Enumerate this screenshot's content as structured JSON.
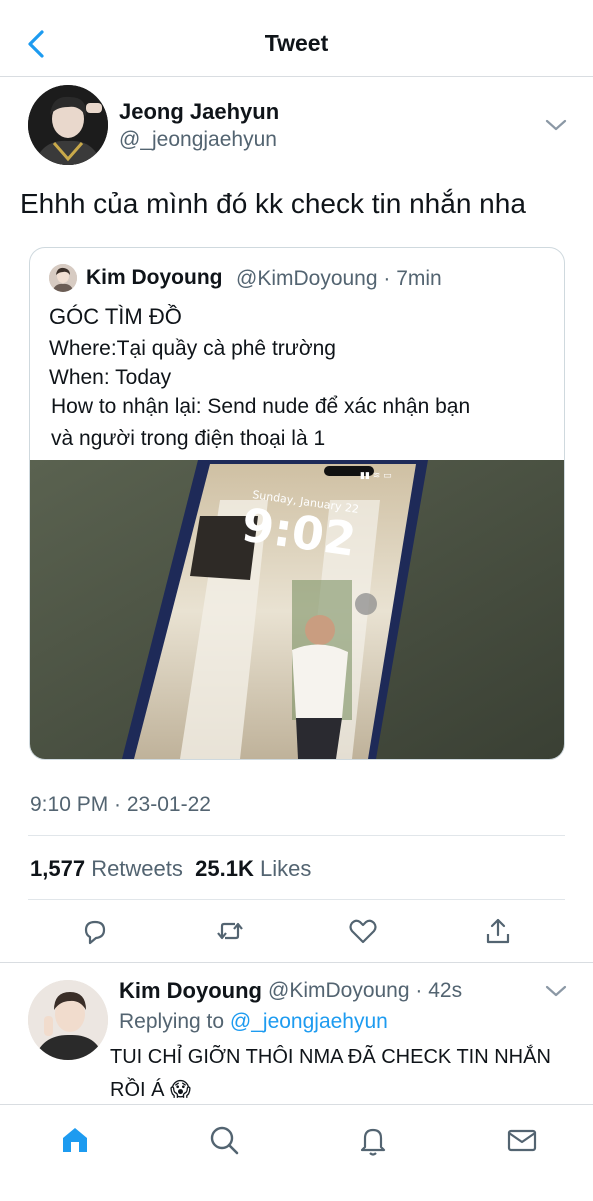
{
  "header": {
    "title": "Tweet",
    "back_icon": "chevron-left-icon"
  },
  "tweet": {
    "author_name": "Jeong Jaehyun",
    "author_handle": "@_jeongjaehyun",
    "text": "Ehhh của mình đó kk check tin nhắn nha",
    "quoted": {
      "author_name": "Kim Doyoung",
      "author_handle": "@KimDoyoung",
      "time": "· 7min",
      "lines": [
        "GÓC TÌM ĐỒ",
        "Where:Tại quầy cà phê trường",
        "When: Today",
        "How to nhận lại: Send nude để xác nhận bạn",
        "và người trong điện thoại là 1"
      ],
      "image": {
        "lock_date": "Sunday, January 22",
        "lock_time": "9:02"
      }
    },
    "timestamp": "9:10 PM · 23-01-22",
    "retweets_count": "1,577",
    "retweets_label": "Retweets",
    "likes_count": "25.1K",
    "likes_label": "Likes"
  },
  "actions": [
    "reply-icon",
    "retweet-icon",
    "like-icon",
    "share-icon"
  ],
  "reply": {
    "author_name": "Kim Doyoung",
    "author_handle": "@KimDoyoung",
    "time": "· 42s",
    "replying_label": "Replying to",
    "replying_handle": "@_jeongjaehyun",
    "text": "TUI CHỈ GIỠN THÔI NMA ĐÃ CHECK TIN NHẮN RỒI Á 😱"
  },
  "tabbar": [
    "home-icon",
    "search-icon",
    "notifications-icon",
    "messages-icon"
  ],
  "colors": {
    "accent": "#1d9bf0",
    "secondary_text": "#536471",
    "border": "#cfd9de"
  }
}
